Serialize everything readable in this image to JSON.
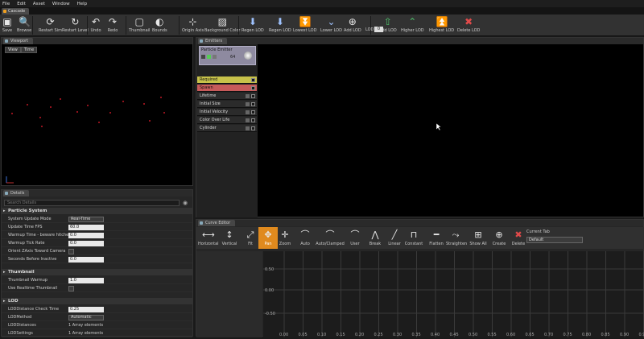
{
  "menu": [
    "File",
    "Edit",
    "Asset",
    "Window",
    "Help"
  ],
  "doc_tab": "Cascade",
  "toolbar": [
    {
      "label": "Save",
      "icon": "save-icon",
      "glyph": "▣"
    },
    {
      "label": "Browse",
      "icon": "browse-icon",
      "glyph": "🔍"
    },
    {
      "label": "Restart Sim",
      "icon": "restart-sim-icon",
      "glyph": "⟳"
    },
    {
      "label": "Restart Level",
      "icon": "restart-level-icon",
      "glyph": "↻"
    },
    {
      "label": "Undo",
      "icon": "undo-icon",
      "glyph": "↶"
    },
    {
      "label": "Redo",
      "icon": "redo-icon",
      "glyph": "↷"
    },
    {
      "label": "Thumbnail",
      "icon": "thumbnail-icon",
      "glyph": "▢"
    },
    {
      "label": "Bounds",
      "icon": "bounds-icon",
      "glyph": "◐"
    },
    {
      "label": "Origin Axis",
      "icon": "origin-axis-icon",
      "glyph": "⊹"
    },
    {
      "label": "Background Color",
      "icon": "background-color-icon",
      "glyph": "▨"
    },
    {
      "label": "Regen LOD",
      "icon": "regen-lod-icon",
      "glyph": "⬇"
    },
    {
      "label": "Regen LOD",
      "icon": "regen-lod-2-icon",
      "glyph": "⬇"
    },
    {
      "label": "Lowest LOD",
      "icon": "lowest-lod-icon",
      "glyph": "⏬"
    },
    {
      "label": "Lower LOD",
      "icon": "lower-lod-icon",
      "glyph": "⌄"
    },
    {
      "label": "Add LOD",
      "icon": "add-lod-icon",
      "glyph": "⊕"
    },
    {
      "label": "Add LOD",
      "icon": "add-lod-2-icon",
      "glyph": "⇧"
    },
    {
      "label": "Higher LOD",
      "icon": "higher-lod-icon",
      "glyph": "⌃"
    },
    {
      "label": "Highest LOD",
      "icon": "highest-lod-icon",
      "glyph": "⏫"
    },
    {
      "label": "Delete LOD",
      "icon": "delete-lod-icon",
      "glyph": "✖"
    }
  ],
  "lod_label": "LOD",
  "lod_value": "0",
  "viewport": {
    "title": "Viewport",
    "view_btn": "View",
    "time_btn": "Time"
  },
  "emitters": {
    "title": "Emitters",
    "emitter_name": "Particle Emitter",
    "emitter_count": "64",
    "modules": [
      "Required",
      "Spawn",
      "Lifetime",
      "Initial Size",
      "Initial Velocity",
      "Color Over Life",
      "Cylinder"
    ]
  },
  "details": {
    "title": "Details",
    "search_placeholder": "Search Details",
    "particle_system": "Particle System",
    "rows": [
      {
        "label": "System Update Mode",
        "value": "Real-Time"
      },
      {
        "label": "Update Time FPS",
        "value": "60.0"
      },
      {
        "label": "Warmup Time - beware hitches!",
        "value": "0.0"
      },
      {
        "label": "Warmup Tick Rate",
        "value": "0.0"
      },
      {
        "label": "Orient ZAxis Toward Camera",
        "value": ""
      },
      {
        "label": "Seconds Before Inactive",
        "value": "0.0"
      }
    ],
    "thumbnail": "Thumbnail",
    "thumb_rows": [
      {
        "label": "Thumbnail Warmup",
        "value": "1.0"
      },
      {
        "label": "Use Realtime Thumbnail",
        "value": ""
      }
    ],
    "lod": "LOD",
    "lod_rows": [
      {
        "label": "LODDistance Check Time",
        "value": "0.25"
      },
      {
        "label": "LODMethod",
        "value": "Automatic"
      },
      {
        "label": "LODDistances",
        "value": "1 Array elements"
      },
      {
        "label": "LODSettings",
        "value": "1 Array elements"
      }
    ]
  },
  "curve": {
    "title": "Curve Editor",
    "tools": [
      "Horizontal",
      "Vertical",
      "Fit",
      "Pan",
      "Zoom",
      "Auto",
      "Auto/Clamped",
      "User",
      "Break",
      "Linear",
      "Constant",
      "Flatten",
      "Straighten",
      "Show All",
      "Create",
      "Delete"
    ],
    "tool_icons": [
      "horizontal-icon",
      "vertical-icon",
      "fit-icon",
      "pan-icon",
      "zoom-icon",
      "auto-icon",
      "auto-clamped-icon",
      "user-icon",
      "break-icon",
      "linear-icon",
      "constant-icon",
      "flatten-icon",
      "straighten-icon",
      "show-all-icon",
      "create-icon",
      "delete-icon"
    ],
    "current_tab_label": "Current Tab",
    "current_tab_value": "Default",
    "y_ticks": [
      "0.50",
      "0.00",
      "-0.50"
    ],
    "x_ticks": [
      "0.00",
      "0.05",
      "0.10",
      "0.15",
      "0.20",
      "0.25",
      "0.30",
      "0.35",
      "0.40",
      "0.45",
      "0.50",
      "0.55",
      "0.60",
      "0.65",
      "0.70",
      "0.75",
      "0.80",
      "0.85",
      "0.90",
      "0.95"
    ]
  }
}
